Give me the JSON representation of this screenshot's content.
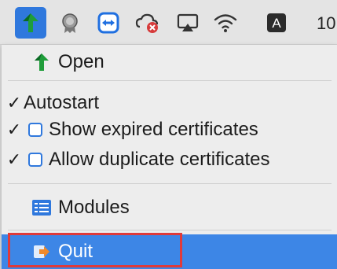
{
  "menubar": {
    "icons": [
      {
        "name": "app-tree-icon",
        "active": true
      },
      {
        "name": "certificate-seal-icon"
      },
      {
        "name": "teamviewer-icon"
      },
      {
        "name": "creative-cloud-sync-icon"
      },
      {
        "name": "airplay-icon"
      },
      {
        "name": "wifi-icon"
      },
      {
        "name": "input-source-a-icon",
        "letter": "A"
      }
    ],
    "clock": "10"
  },
  "menu": {
    "open": "Open",
    "autostart": "Autostart",
    "show_expired": "Show expired certificates",
    "allow_duplicate": "Allow duplicate certificates",
    "modules": "Modules",
    "quit": "Quit",
    "check_mark": "✓"
  },
  "colors": {
    "accent": "#2f78dd",
    "highlight": "#3d86e6",
    "tree_green": "#1f9d3a",
    "outline_red": "#e03a3a"
  }
}
